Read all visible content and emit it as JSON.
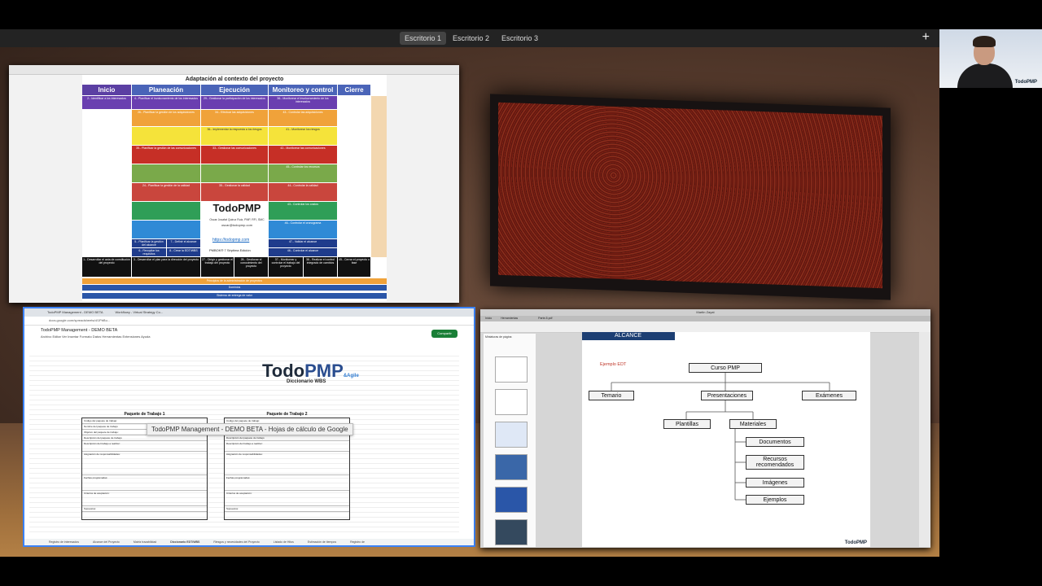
{
  "desktops": {
    "tabs": [
      "Escritorio 1",
      "Escritorio 2",
      "Escritorio 3"
    ],
    "active": 0
  },
  "webcam": {
    "logo": "TodoPMP"
  },
  "slide": {
    "title": "Adaptación al contexto del proyecto",
    "phases": [
      "Inicio",
      "Planeación",
      "Ejecución",
      "Monitoreo y control",
      "Cierre"
    ],
    "phase_colors": [
      "#5b3fa3",
      "#4a64b8",
      "#4a64b8",
      "#4a64b8",
      "#4a64b8"
    ],
    "cells": [
      "2.- Identificar a los interesados",
      "4.- Planificar el involucramiento de los interesados",
      "29.- Gestionar la participación de los interesados",
      "36.- Monitorear el involucramiento de los interesados",
      "26.- Planificar la gestión de los adquisiciones",
      "34.- Efectuar las adquisiciones",
      "43.- Controlar las adquisiciones",
      "36.- Implementar la respuesta a los riesgos",
      "41.- Monitorear los riesgos",
      "35.- Planificar la gestión de las comunicaciones",
      "33.- Gestionar las comunicaciones",
      "42.- Monitorear las comunicaciones",
      "45.- Controlar los recursos",
      "24.- Planificar la gestión de la calidad",
      "35.- Gestionar la calidad",
      "44.- Controlar la calidad",
      "43.- Controlar los costos",
      "46.- Controlar el cronograma",
      "5.- Planificar la gestión del alcance",
      "7.- Definir el alcance",
      "6.- Recopilar los requisitos",
      "8.- Crear la EDT/WBS",
      "47.- Validar el alcance",
      "46.- Controlar el alcance",
      "1.- Desarrollar el acta de constitución del proyecto",
      "3.- Desarrollar el plan para la dirección del proyecto",
      "27.- Dirigir y gestionar el trabajo del proyecto",
      "28.- Gestionar el conocimiento del proyecto",
      "37.- Monitorear y controlar el trabajo del proyecto",
      "38.- Realizar el control integrado de cambios",
      "45.- Cerrar el proyecto o fase"
    ],
    "logo": "TodoPMP",
    "author": "Oscar Josafat Quiroz Ruiz, PMP, RFI, SMC",
    "email": "oscar@todopmp.com",
    "url": "https://todopmp.com",
    "pmbok": "PMBOK® 7 Séptima Edición",
    "bands": [
      "Principios de la administración de proyectos",
      "Dominios",
      "Sistema de entrega de valor"
    ]
  },
  "sheets": {
    "tabs": [
      "TodoPMP Management - DEMO BETA",
      "Workflowy - Virtual Strategy Co..."
    ],
    "url": "docs.google.com/spreadsheets/d/1PbBu...",
    "doc_title": "TodoPMP Management - DEMO BETA",
    "menu": "Archivo  Editar  Ver  Insertar  Formato  Datos  Herramientas  Extensiones  Ayuda",
    "share": "Compartir",
    "logo_main": "Todo",
    "logo_accent": "PMP",
    "logo_sub": "&Agile",
    "subtitle": "Diccionario WBS",
    "wp1": "Paquete de Trabajo 1",
    "wp2": "Paquete de Trabajo 2",
    "rows": [
      "Código del paquete de trabajo:",
      "Nombre del paquete de trabajo:",
      "Objetivo del paquete de trabajo:",
      "Descripción del paquete de trabajo:",
      "Descripción del trabajo a realizar:",
      "Asignación de responsabilidades:",
      "Fechas programadas:",
      "Criterios de aceptación:",
      "Supuestos:"
    ],
    "tooltip": "TodoPMP Management - DEMO BETA - Hojas de cálculo de Google",
    "sheet_tabs": [
      "Registro de interesados",
      "Alcance del Proyecto",
      "Matriz trazabilidad",
      "Diccionario EDT/WBS",
      "Riesgos y necesidades del Proyecto",
      "Listado de Hitos",
      "Estimación de tiempos",
      "Registro de"
    ]
  },
  "pdf": {
    "window_title": "Martin Zayat",
    "tabs": [
      "Inicio",
      "Herramientas",
      "Parte-5.pdf"
    ],
    "sidebar_title": "Miniaturas de página",
    "header": "ALCANCE",
    "example": "Ejemplo EDT",
    "root": "Curso PMP",
    "level1": [
      "Temario",
      "Presentaciones",
      "Exámenes"
    ],
    "level2": [
      "Plantillas",
      "Materiales"
    ],
    "level3": [
      "Documentos",
      "Recursos recomendados",
      "Imágenes",
      "Ejemplos"
    ],
    "logo": "TodoPMP"
  }
}
